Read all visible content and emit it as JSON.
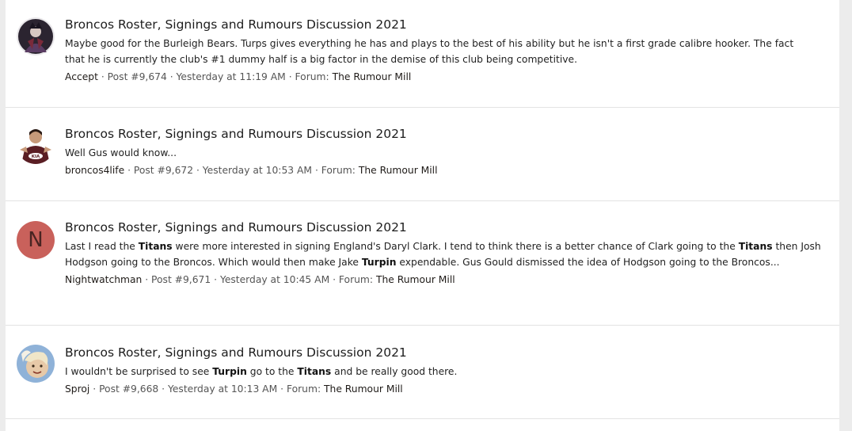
{
  "results": [
    {
      "title": "Broncos Roster, Signings and Rumours Discussion 2021",
      "snippet_lines": [
        "Maybe good for the Burleigh Bears. Turps gives everything he has and plays to the best of his ability but he isn't a first grade calibre hooker. The fact",
        "that he is currently the club's #1 dummy half is a big factor in the demise of this club being competitive."
      ],
      "user": "Accept",
      "post": "Post #9,674",
      "time": "Yesterday at 11:19 AM",
      "forum_prefix": "Forum:",
      "forum": "The Rumour Mill"
    },
    {
      "title": "Broncos Roster, Signings and Rumours Discussion 2021",
      "snippet_lines": [
        "Well Gus would know..."
      ],
      "user": "broncos4life",
      "post": "Post #9,672",
      "time": "Yesterday at 10:53 AM",
      "forum_prefix": "Forum:",
      "forum": "The Rumour Mill",
      "avatar_badge": "KIA"
    },
    {
      "title": "Broncos Roster, Signings and Rumours Discussion 2021",
      "snippet": {
        "p1": "Last I read the ",
        "b1": "Titans",
        "p2": " were more interested in signing England's Daryl Clark. I tend to think there is a better chance of Clark going to the ",
        "b2": "Titans",
        "p3": " then Josh Hodgson going to the Broncos. Which would then make Jake ",
        "b3": "Turpin",
        "p4": " expendable. Gus Gould dismissed the idea of Hodgson going to the Broncos..."
      },
      "user": "Nightwatchman",
      "post": "Post #9,671",
      "time": "Yesterday at 10:45 AM",
      "forum_prefix": "Forum:",
      "forum": "The Rumour Mill",
      "avatar_letter": "N"
    },
    {
      "title": "Broncos Roster, Signings and Rumours Discussion 2021",
      "snippet": {
        "p1": "I wouldn't be surprised to see ",
        "b1": "Turpin",
        "p2": " go to the ",
        "b2": "Titans",
        "p3": " and be really good there."
      },
      "user": "Sproj",
      "post": "Post #9,668",
      "time": "Yesterday at 10:13 AM",
      "forum_prefix": "Forum:",
      "forum": "The Rumour Mill"
    }
  ],
  "meta_separator": " · ",
  "colors": {
    "background": "#ececec",
    "panel": "#ffffff",
    "divider": "#e3e3e3",
    "letter_avatar": "#c9615b"
  }
}
